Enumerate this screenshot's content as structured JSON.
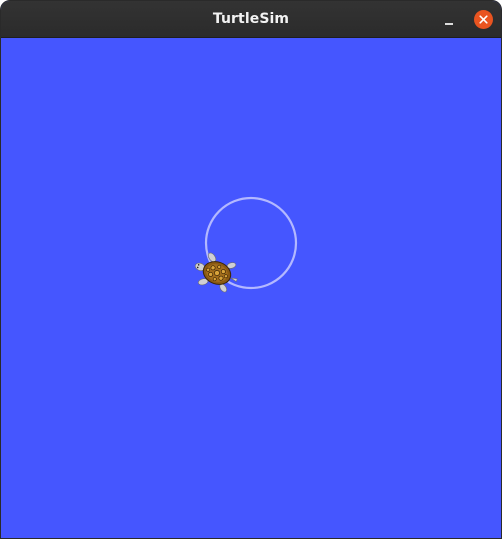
{
  "window": {
    "title": "TurtleSim",
    "background_color": "#4556ff",
    "pen_color": "#b3b8ff",
    "controls": [
      "minimize-icon",
      "close-icon"
    ]
  },
  "turtle": {
    "icon": "turtle-icon",
    "shell_color": "#8a5a14",
    "skin_color": "#cfcfd4"
  }
}
